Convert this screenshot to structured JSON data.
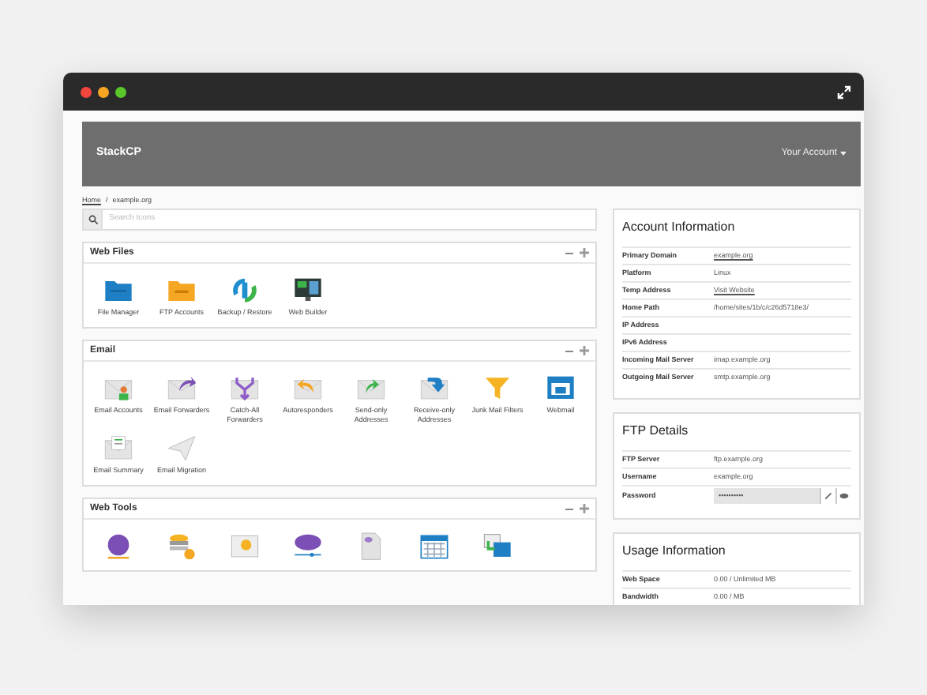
{
  "header": {
    "brand": "StackCP",
    "account_menu": "Your Account"
  },
  "breadcrumb": {
    "items": [
      {
        "label": "Home",
        "link": true
      },
      {
        "label": "example.org",
        "link": false
      }
    ],
    "separator": "/"
  },
  "search": {
    "placeholder": "Search Icons"
  },
  "panels": [
    {
      "title": "Web Files",
      "items": [
        {
          "label": "File Manager"
        },
        {
          "label": "FTP Accounts"
        },
        {
          "label": "Backup / Restore"
        },
        {
          "label": "Web Builder"
        }
      ]
    },
    {
      "title": "Email",
      "items": [
        {
          "label": "Email Accounts"
        },
        {
          "label": "Email Forwarders"
        },
        {
          "label": "Catch-All Forwarders"
        },
        {
          "label": "Autoresponders"
        },
        {
          "label": "Send-only Addresses"
        },
        {
          "label": "Receive-only Addresses"
        },
        {
          "label": "Junk Mail Filters"
        },
        {
          "label": "Webmail"
        },
        {
          "label": "Email Summary"
        },
        {
          "label": "Email Migration"
        }
      ]
    },
    {
      "title": "Web Tools"
    }
  ],
  "cards": [
    {
      "title": "Account Information",
      "rows": [
        {
          "label": "Primary Domain",
          "value": "example.org",
          "kind": "link"
        },
        {
          "label": "Platform",
          "value": "Linux",
          "kind": "text"
        },
        {
          "label": "Temp Address",
          "value": "Visit Website",
          "kind": "link"
        },
        {
          "label": "Home Path",
          "value": "/home/sites/1b/c/c26d5718e3/",
          "kind": "text"
        },
        {
          "label": "IP Address",
          "kind": "text"
        },
        {
          "label": "IPv6 Address",
          "kind": "text"
        },
        {
          "label": "Incoming Mail Server",
          "value": "imap.example.org",
          "kind": "text"
        },
        {
          "label": "Outgoing Mail Server",
          "value": "smtp.example.org",
          "kind": "text"
        }
      ]
    },
    {
      "title": "FTP Details",
      "rows": [
        {
          "label": "FTP Server",
          "value": "ftp.example.org",
          "kind": "text"
        },
        {
          "label": "Username",
          "value": "example.org",
          "kind": "text"
        },
        {
          "label": "Password",
          "value": "••••••••••",
          "kind": "password"
        }
      ]
    },
    {
      "title": "Usage Information",
      "rows": [
        {
          "label": "Web Space",
          "value": "0.00 / Unlimited MB",
          "kind": "text"
        },
        {
          "label": "Bandwidth",
          "value": "0.00 / MB",
          "kind": "text"
        }
      ]
    }
  ]
}
